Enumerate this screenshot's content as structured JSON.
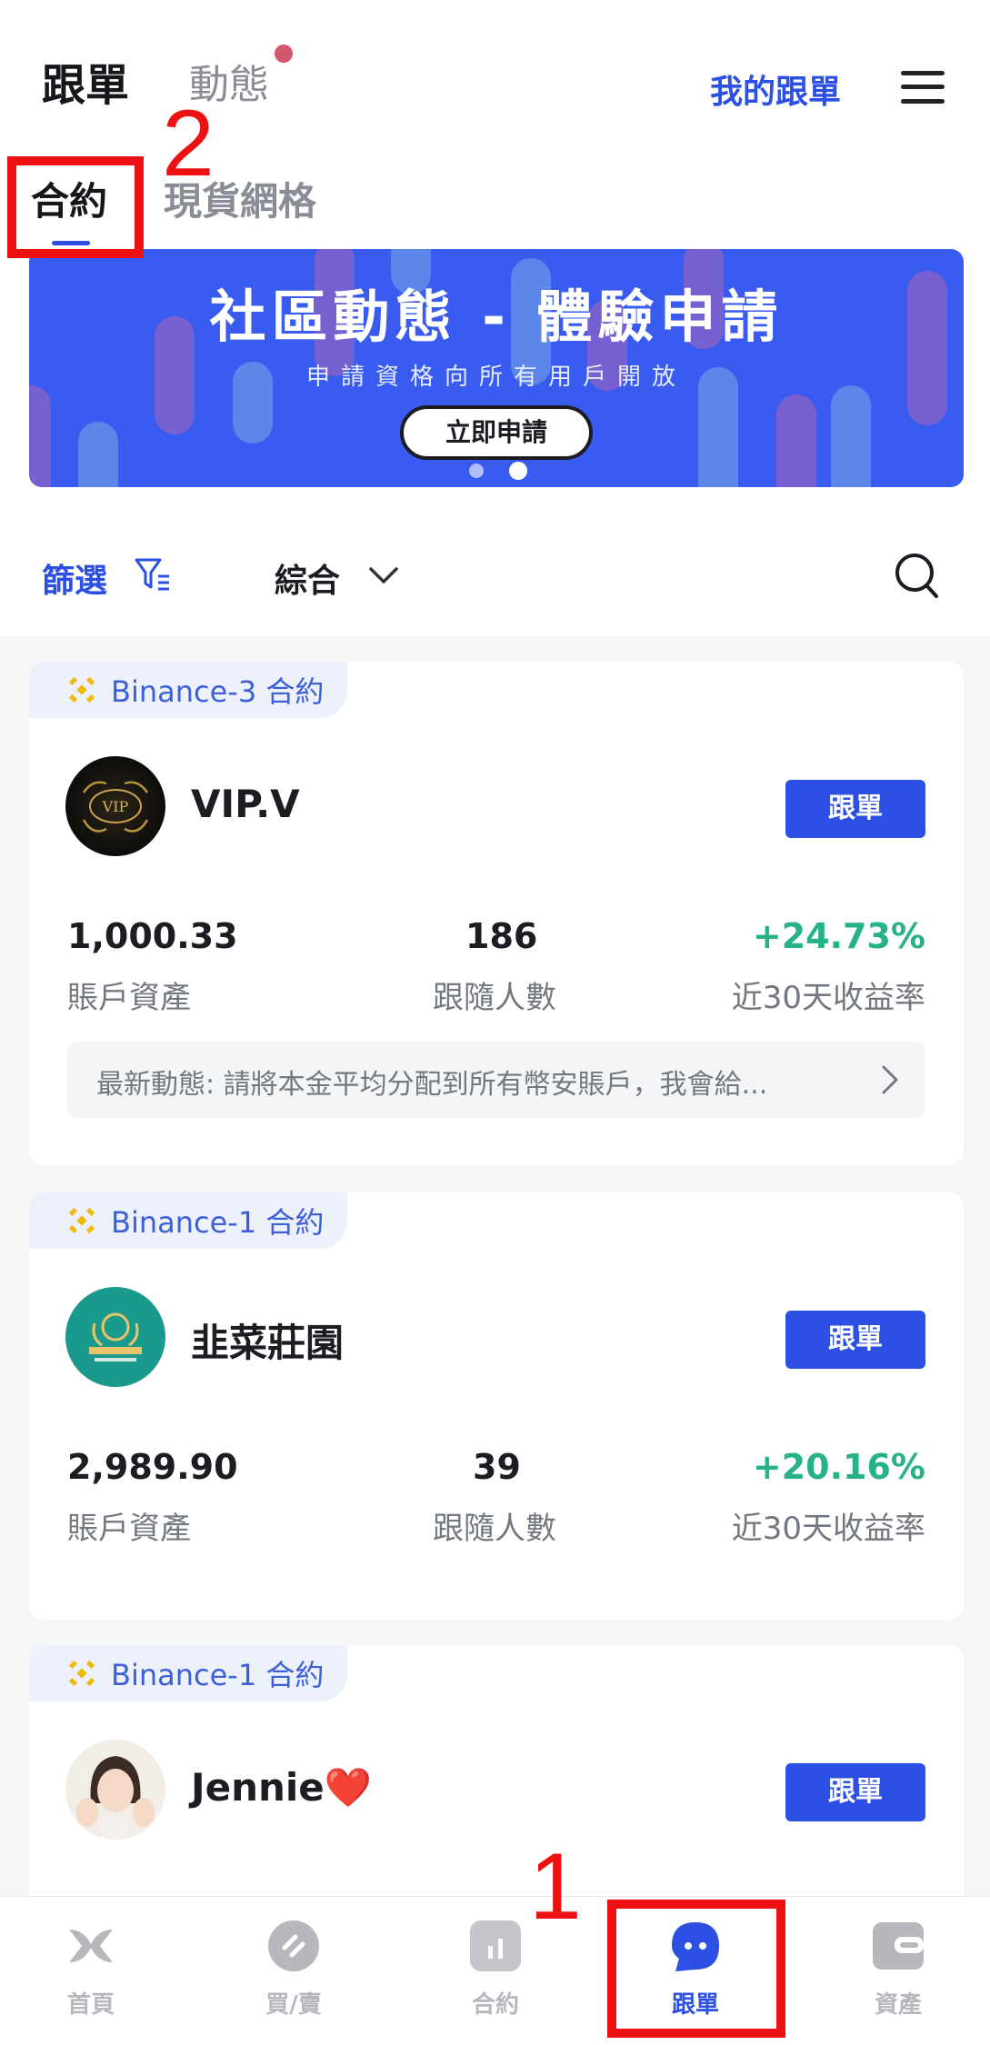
{
  "header": {
    "tab_active": "跟單",
    "tab_inactive": "動態",
    "my_copy_link": "我的跟單",
    "sub_tab_active": "合約",
    "sub_tab_inactive": "現貨網格"
  },
  "banner": {
    "title": "社區動態 - 體驗申請",
    "subtitle": "申請資格向所有用戶開放",
    "button": "立即申請"
  },
  "filter": {
    "filter_label": "篩選",
    "sort_label": "綜合"
  },
  "cards": [
    {
      "tag": "Binance-3 合約",
      "name": "VIP.V",
      "follow": "跟單",
      "assets": "1,000.33",
      "assets_label": "賬戶資產",
      "followers": "186",
      "followers_label": "跟隨人數",
      "roi": "+24.73%",
      "roi_label": "近30天收益率",
      "news": "最新動態: 請將本金平均分配到所有幣安賬戶，我會給..."
    },
    {
      "tag": "Binance-1 合約",
      "name": "韭菜莊園",
      "follow": "跟單",
      "assets": "2,989.90",
      "assets_label": "賬戶資產",
      "followers": "39",
      "followers_label": "跟隨人數",
      "roi": "+20.16%",
      "roi_label": "近30天收益率"
    },
    {
      "tag": "Binance-1 合約",
      "name": "Jennie❤️",
      "follow": "跟單"
    }
  ],
  "nav": [
    {
      "label": "首頁",
      "icon": "home-icon"
    },
    {
      "label": "買/賣",
      "icon": "trade-icon"
    },
    {
      "label": "合約",
      "icon": "contract-icon"
    },
    {
      "label": "跟單",
      "icon": "copy-trade-icon",
      "active": true
    },
    {
      "label": "資產",
      "icon": "wallet-icon"
    }
  ],
  "annotations": {
    "num1": "1",
    "num2": "2"
  },
  "colors": {
    "accent": "#2c4fe4",
    "positive": "#28b28a",
    "annotation": "#ee1111",
    "banner": "#3a5bf0"
  }
}
